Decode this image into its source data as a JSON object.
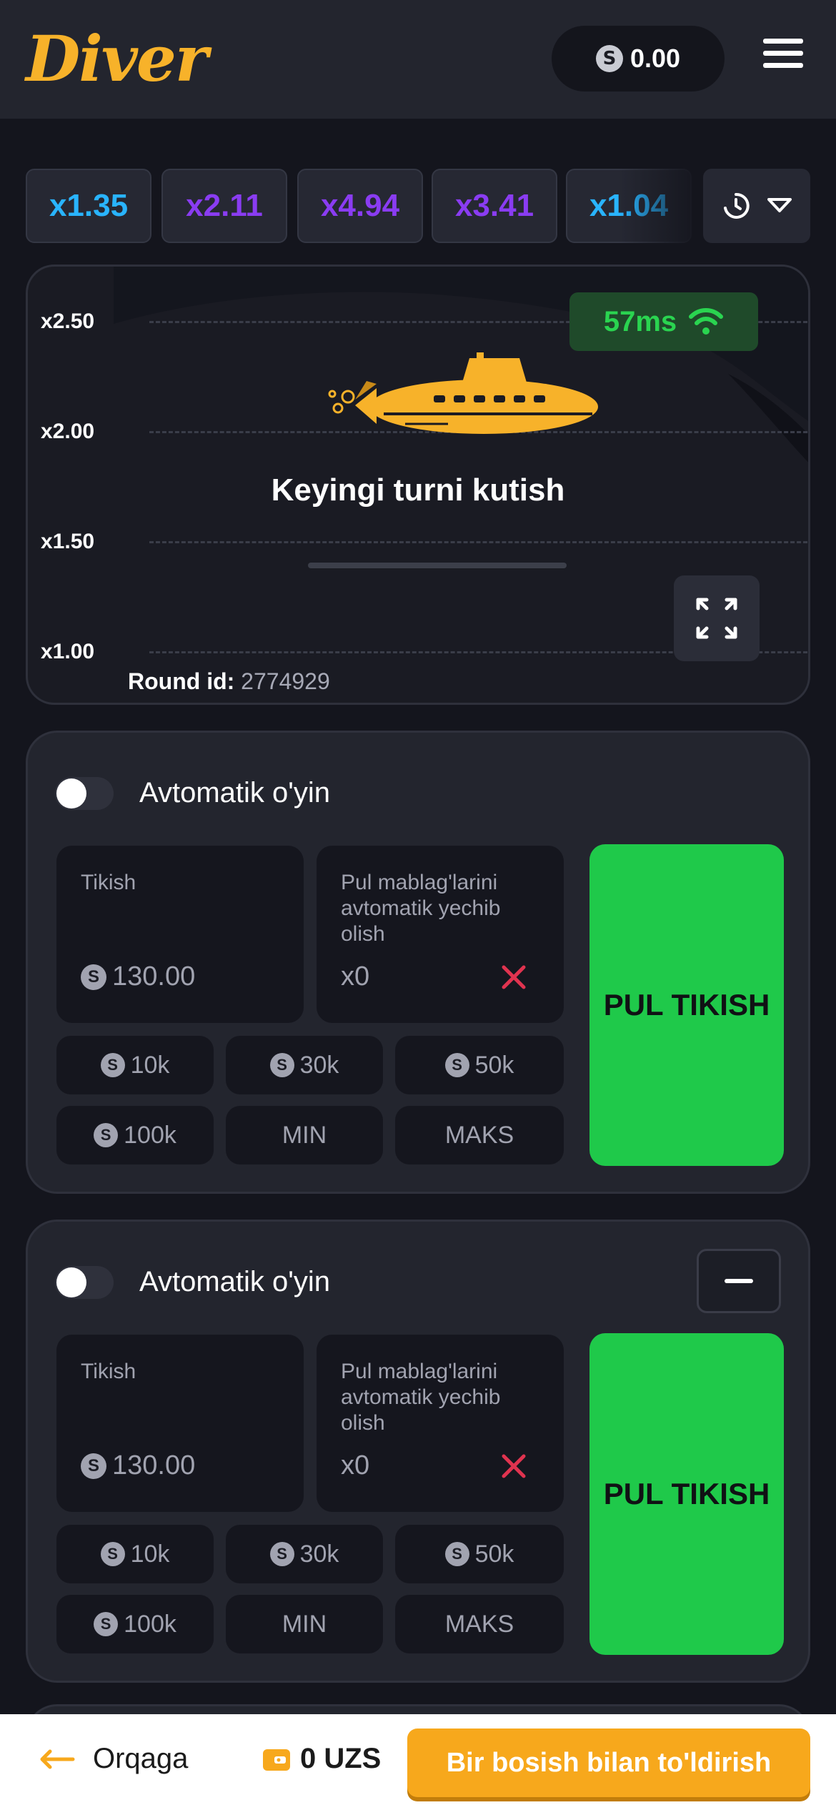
{
  "header": {
    "logo_text": "Diver",
    "balance": "0.00",
    "coin_symbol": "S"
  },
  "history": {
    "multipliers": [
      {
        "value": "x1.35",
        "color": "#29b4ff"
      },
      {
        "value": "x2.11",
        "color": "#8a3cf2"
      },
      {
        "value": "x4.94",
        "color": "#8a3cf2"
      },
      {
        "value": "x3.41",
        "color": "#8a3cf2"
      },
      {
        "value": "x1.04",
        "color": "#29b4ff"
      }
    ]
  },
  "game": {
    "y_labels": [
      "x2.50",
      "x2.00",
      "x1.50",
      "x1.00"
    ],
    "ping": "57ms",
    "status_text": "Keyingi turni kutish",
    "round_label": "Round id:",
    "round_value": "2774929"
  },
  "panels": [
    {
      "auto_label": "Avtomatik o'yin",
      "bet_label": "Tikish",
      "bet_value": "130.00",
      "cashout_label": "Pul mablag'larini avtomatik yechib olish",
      "cashout_value": "x0",
      "chips": [
        "10k",
        "30k",
        "50k",
        "100k"
      ],
      "min_label": "MIN",
      "max_label": "MAKS",
      "bet_button": "PUL TIKISH"
    },
    {
      "auto_label": "Avtomatik o'yin",
      "bet_label": "Tikish",
      "bet_value": "130.00",
      "cashout_label": "Pul mablag'larini avtomatik yechib olish",
      "cashout_value": "x0",
      "chips": [
        "10k",
        "30k",
        "50k",
        "100k"
      ],
      "min_label": "MIN",
      "max_label": "MAKS",
      "bet_button": "PUL TIKISH"
    }
  ],
  "bottom_bar": {
    "back_label": "Orqaga",
    "wallet_value": "0 UZS",
    "topup_label": "Bir bosish bilan to'ldirish"
  },
  "colors": {
    "accent_yellow": "#f7b22a",
    "bet_green": "#1fc94a",
    "ping_green": "#2ad450",
    "topup_orange": "#f7a81c"
  }
}
